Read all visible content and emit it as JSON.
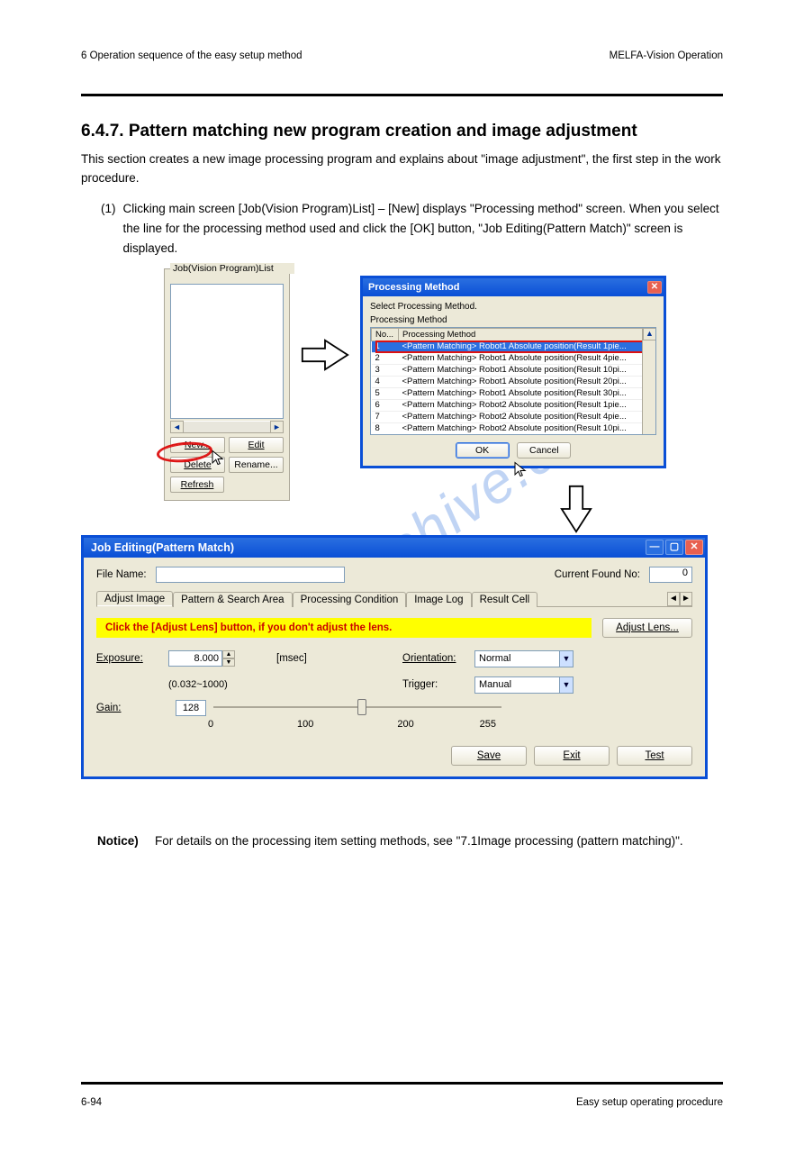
{
  "header": {
    "left": "6 Operation sequence of the easy setup method",
    "right": "MELFA-Vision Operation"
  },
  "footer": {
    "left": "6-94",
    "right": "Easy setup operating procedure"
  },
  "section": {
    "title": "6.4.7. Pattern matching new program creation and image adjustment",
    "p1": "This section creates a new image processing program and explains about \"image adjustment\", the first step in the work procedure.",
    "step1_num": "(1)",
    "step1_text": "Clicking main screen [Job(Vision Program)List] – [New] displays \"Processing method\" screen. When you select the line for the processing method used and click the [OK] button, \"Job Editing(Pattern Match)\" screen is displayed."
  },
  "joblist": {
    "title": "Job(Vision Program)List",
    "buttons": {
      "new": "New...",
      "edit": "Edit",
      "delete": "Delete",
      "rename": "Rename...",
      "refresh": "Refresh"
    }
  },
  "pm": {
    "title": "Processing Method",
    "subtitle": "Select Processing Method.",
    "group_label": "Processing Method",
    "col_no": "No...",
    "col_method": "Processing Method",
    "rows": [
      {
        "no": "1",
        "txt": "<Pattern Matching> Robot1 Absolute position(Result 1pie..."
      },
      {
        "no": "2",
        "txt": "<Pattern Matching> Robot1 Absolute position(Result 4pie..."
      },
      {
        "no": "3",
        "txt": "<Pattern Matching> Robot1 Absolute position(Result 10pi..."
      },
      {
        "no": "4",
        "txt": "<Pattern Matching> Robot1 Absolute position(Result 20pi..."
      },
      {
        "no": "5",
        "txt": "<Pattern Matching> Robot1 Absolute position(Result 30pi..."
      },
      {
        "no": "6",
        "txt": "<Pattern Matching> Robot2 Absolute position(Result 1pie..."
      },
      {
        "no": "7",
        "txt": "<Pattern Matching> Robot2 Absolute position(Result 4pie..."
      },
      {
        "no": "8",
        "txt": "<Pattern Matching> Robot2 Absolute position(Result 10pi..."
      }
    ],
    "ok": "OK",
    "cancel": "Cancel"
  },
  "je": {
    "title": "Job Editing(Pattern Match)",
    "file_name_label": "File Name:",
    "file_name_value": "",
    "current_found_label": "Current Found No:",
    "current_found_value": "0",
    "tabs": [
      "Adjust Image",
      "Pattern & Search Area",
      "Processing Condition",
      "Image Log",
      "Result Cell"
    ],
    "banner": "Click the [Adjust Lens] button, if you don't adjust the lens.",
    "adjust_lens": "Adjust Lens...",
    "exposure_label": "Exposure:",
    "exposure_value": "8.000",
    "exposure_unit": "[msec]",
    "exposure_range": "(0.032~1000)",
    "orientation_label": "Orientation:",
    "orientation_value": "Normal",
    "trigger_label": "Trigger:",
    "trigger_value": "Manual",
    "gain_label": "Gain:",
    "gain_value": "128",
    "gain_ticks": [
      "0",
      "100",
      "200",
      "255"
    ],
    "save": "Save",
    "exit": "Exit",
    "test": "Test"
  },
  "note": {
    "label": "Notice)",
    "text": "For details on the processing item setting methods, see \"7.1Image processing (pattern matching)\"."
  },
  "watermark": "manualshive.co"
}
